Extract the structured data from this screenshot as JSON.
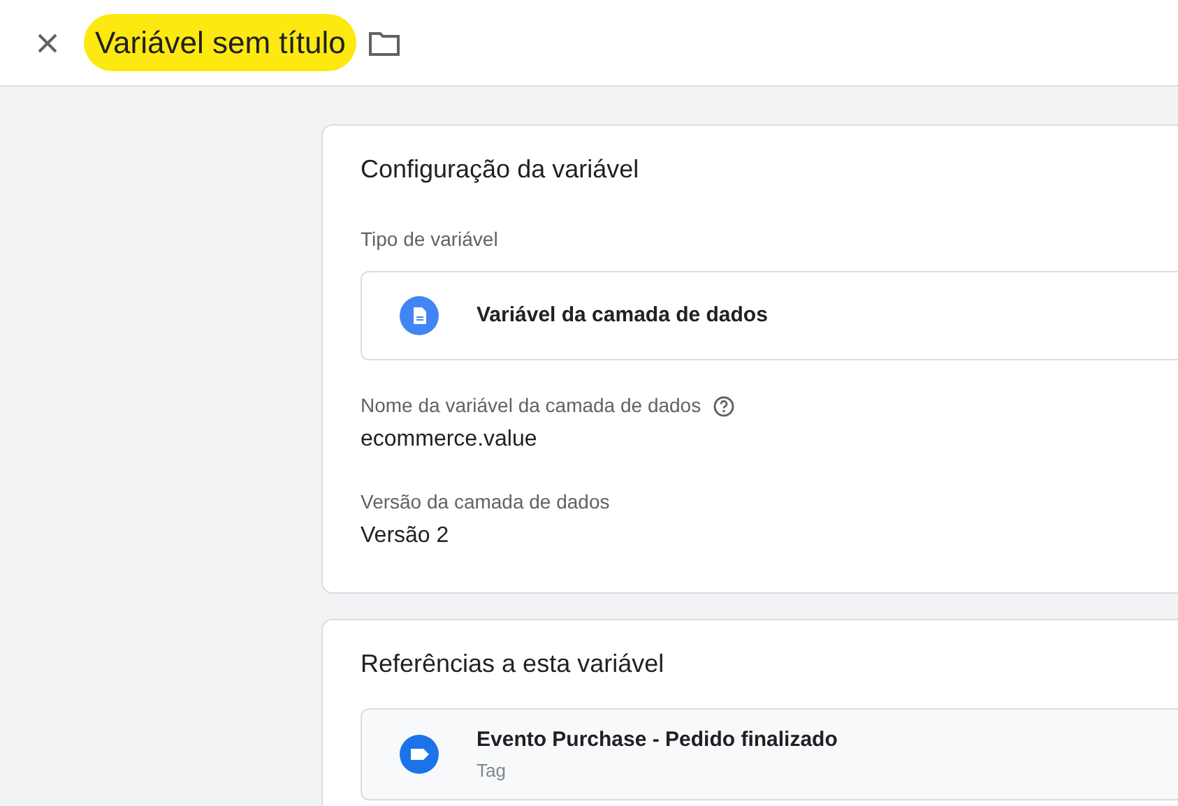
{
  "header": {
    "title": "Variável sem título"
  },
  "config_card": {
    "title": "Configuração da variável",
    "type_label": "Tipo de variável",
    "type_value": "Variável da camada de dados",
    "fields": [
      {
        "label": "Nome da variável da camada de dados",
        "help": true,
        "value": "ecommerce.value"
      },
      {
        "label": "Versão da camada de dados",
        "help": false,
        "value": "Versão 2"
      }
    ]
  },
  "references_card": {
    "title": "Referências a esta variável",
    "items": [
      {
        "kind": "tag",
        "name": "Evento Purchase - Pedido finalizado",
        "type": "Tag"
      }
    ]
  }
}
